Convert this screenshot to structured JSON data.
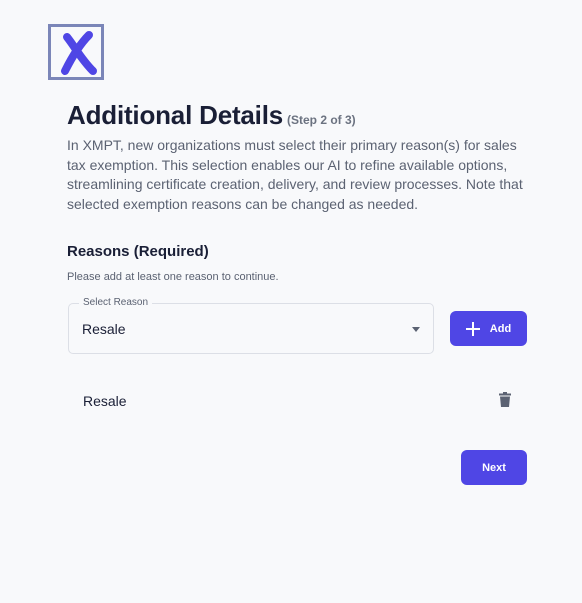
{
  "logo": {
    "icon": "x-logo-icon",
    "brand_color": "#4f46e5",
    "frame_color": "#7b86b8"
  },
  "header": {
    "title": "Additional Details",
    "step": "(Step 2 of 3)",
    "description": "In XMPT, new organizations must select their primary reason(s) for sales tax exemption. This selection enables our AI to refine available options, streamlining certificate creation, delivery, and review processes. Note that selected exemption reasons can be changed as needed."
  },
  "reasons": {
    "title": "Reasons (Required)",
    "hint": "Please add at least one reason to continue.",
    "select_label": "Select Reason",
    "selected_value": "Resale",
    "add_label": "Add",
    "items": [
      {
        "label": "Resale",
        "icon": "trash-icon"
      }
    ]
  },
  "footer": {
    "next_label": "Next"
  },
  "colors": {
    "accent": "#4f46e5",
    "background": "#f8f9fb",
    "text": "#1a1f36",
    "muted": "#5b6272"
  }
}
